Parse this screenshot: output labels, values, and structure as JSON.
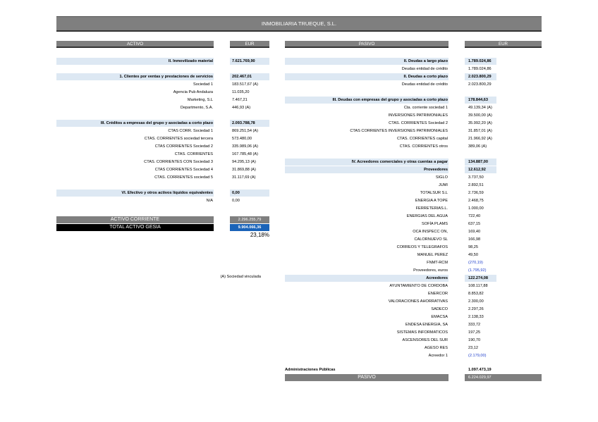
{
  "title": "INMOBILIARIA TRUEQUE, S.L.",
  "headers": {
    "activo": "ACTIVO",
    "eur_left": "EUR",
    "pasivo": "PASIVO",
    "eur_right": "EUR"
  },
  "activo_rows": [
    {
      "label": "II. Inmovilizado material",
      "value": "7.621.769,90",
      "band": true,
      "bold": true
    },
    {
      "label": "",
      "value": "",
      "band": false
    },
    {
      "label": "1. Clientes por ventas y prestaciones de servicios",
      "value": "202.467,01",
      "band": true,
      "bold": true
    },
    {
      "label": "Sociedad 1",
      "value": "183.517,67 (A)",
      "band": false
    },
    {
      "label": "Agencia Pub Andaluza",
      "value": "11.035,20",
      "band": false
    },
    {
      "label": "Marketing, S.L",
      "value": "7.467,21",
      "band": false
    },
    {
      "label": "Departmento, S.A.",
      "value": "446,93 (A)",
      "band": false
    },
    {
      "label": "",
      "value": "",
      "band": false
    },
    {
      "label": "III. Créditos a empresas del grupo y asociadas a corto plazo",
      "value": "2.093.788,78",
      "band": true,
      "bold": true
    },
    {
      "label": "CTAS CORR. Sociedad 1",
      "value": "869.251,54 (A)",
      "band": false
    },
    {
      "label": "CTAS. CORRIENTES sociedad tercera",
      "value": "573.480,00",
      "band": false
    },
    {
      "label": "CTAS CORRIENTES Sociedad 2",
      "value": "335.989,06 (A)",
      "band": false
    },
    {
      "label": "CTAS. CORRIENTES",
      "value": "167.785,48 (A)",
      "band": false
    },
    {
      "label": "CTAS. CORRIENTES CON Sociedad 3",
      "value": "94.295,13 (A)",
      "band": false
    },
    {
      "label": "CTAS CORRIENTES Sociedad 4",
      "value": "31.869,88 (A)",
      "band": false
    },
    {
      "label": "CTAS. CORRIENTES sociedad 5",
      "value": "31.117,69 (A)",
      "band": false
    },
    {
      "label": "",
      "value": "",
      "band": false
    },
    {
      "label": "VI. Efectivo y otros activos líquidos equivalentes",
      "value": "0,00",
      "band": true,
      "bold": true
    },
    {
      "label": "N/A",
      "value": "0,00",
      "band": false
    }
  ],
  "activo_totals": {
    "corriente_label": "ACTIVO CORRIENTE",
    "corriente_value": "2.296.255,79",
    "total_label": "TOTAL ACTIVO GESIA",
    "total_value": "9.904.066,36",
    "percent": "23,18%"
  },
  "footnote": "(A) Sociedad vinculada",
  "pasivo_rows": [
    {
      "label": "II. Deudas a largo plazo",
      "value": "1.789.024,86",
      "band": true,
      "bold": true
    },
    {
      "label": "Deudas entidad de crédito",
      "value": "1.789.024,86",
      "band": false
    },
    {
      "label": "II. Deudas a corto plazo",
      "value": "2.023.800,29",
      "band": true,
      "bold": true
    },
    {
      "label": "Deudas entidad de crédito",
      "value": "2.023.800,29",
      "band": false
    },
    {
      "label": "",
      "value": "",
      "band": false
    },
    {
      "label": "III. Deudas con empresas del grupo y asociadas a corto plazo",
      "value": "178.844,63",
      "band": true,
      "bold": true
    },
    {
      "label": "Cta. corriente sociedad 1",
      "value": "49.139,34 (A)",
      "band": false
    },
    {
      "label": "INVERSIONES PATRIMONIALES",
      "value": "39.500,00 (A)",
      "band": false
    },
    {
      "label": "CTAS. CORRIENTES Sociedad 2",
      "value": "35.992,20 (A)",
      "band": false
    },
    {
      "label": "CTAS CORRIENTES INVERSIONES PATRIMONIALES",
      "value": "31.857,01 (A)",
      "band": false
    },
    {
      "label": "CTAS. CORRIENTES capital",
      "value": "21.966,92 (A)",
      "band": false
    },
    {
      "label": "CTAS. CORRIENTES otros",
      "value": "389,06 (A)",
      "band": false
    },
    {
      "label": "",
      "value": "",
      "band": false
    },
    {
      "label": "IV. Acreedores comerciales y otras cuentas a pagar",
      "value": "134.887,00",
      "band": true,
      "bold": true
    },
    {
      "label": "Proveedores",
      "value": "12.612,92",
      "band": true,
      "bold": true
    },
    {
      "label": "SIGLO",
      "value": "3.737,50",
      "band": false
    },
    {
      "label": "JUMI",
      "value": "2.892,51",
      "band": false
    },
    {
      "label": "TOTALSUR S.L",
      "value": "2.736,59",
      "band": false
    },
    {
      "label": "ENERGIA A TOPE",
      "value": "2.468,75",
      "band": false
    },
    {
      "label": "FERRETERIAS.L.",
      "value": "1.000,00",
      "band": false
    },
    {
      "label": "ENERGIAS DEL AGUA",
      "value": "722,40",
      "band": false
    },
    {
      "label": "SOFÍA PLAMS",
      "value": "637,15",
      "band": false
    },
    {
      "label": "OCA INSPECC ON,",
      "value": "169,40",
      "band": false
    },
    {
      "label": "CALORNUEVO SL",
      "value": "166,98",
      "band": false
    },
    {
      "label": "CORREOS Y TELEGRAFOS",
      "value": "98,25",
      "band": false
    },
    {
      "label": "MANUEL PEREZ",
      "value": "49,50",
      "band": false
    },
    {
      "label": "FNMT-RCM",
      "value": "(270,19)",
      "band": false,
      "blue": true
    },
    {
      "label": "Proveedores, euros",
      "value": "(1.795,92)",
      "band": false,
      "blue": true
    },
    {
      "label": "Acreedores",
      "value": "122.274,08",
      "band": true,
      "bold": true
    },
    {
      "label": "AYUNTAMIENTO DE CORDOBA",
      "value": "108.117,88",
      "band": false
    },
    {
      "label": "ENERCOR",
      "value": "8.853,82",
      "band": false
    },
    {
      "label": "VALORACIONES AHORRATIVAS",
      "value": "2.300,00",
      "band": false
    },
    {
      "label": "SADECO",
      "value": "2.297,26",
      "band": false
    },
    {
      "label": "EMACSA",
      "value": "2.138,33",
      "band": false
    },
    {
      "label": "ENDESA ENERGIA, SA",
      "value": "333,72",
      "band": false
    },
    {
      "label": "SISTEMAS INFORMATICOS",
      "value": "197,25",
      "band": false
    },
    {
      "label": "ASCENSORES DEL SUR",
      "value": "190,70",
      "band": false
    },
    {
      "label": "AGESO RES",
      "value": "23,12",
      "band": false
    },
    {
      "label": "Acreedor 1",
      "value": "(2.179,00)",
      "band": false,
      "blue": true
    }
  ],
  "administraciones": {
    "label": "Administraciones Públicas",
    "value": "1.097.473,19"
  },
  "pasivo_total": {
    "label": "PASIVO",
    "value": "6.224.029,97"
  }
}
